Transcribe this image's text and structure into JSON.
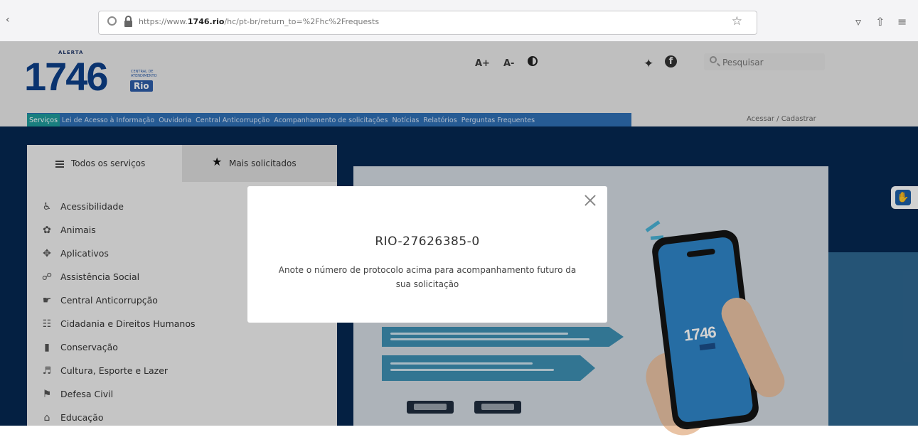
{
  "browser": {
    "url_prefix": "https://www.",
    "url_domain": "1746.rio",
    "url_path": "/hc/pt-br/return_to=%2Fhc%2Frequests"
  },
  "header": {
    "logo_top": "ALERTA",
    "logo_number": "1746",
    "logo_sub": "CENTRAL DE ATENDIMENTO",
    "logo_rio": "Rio",
    "font_increase": "A+",
    "font_decrease": "A-",
    "search_placeholder": "Pesquisar",
    "right_link": "Acessar / Cadastrar"
  },
  "nav": {
    "items": [
      {
        "label": "Serviços",
        "active": true
      },
      {
        "label": "Lei de Acesso à Informação",
        "active": false
      },
      {
        "label": "Ouvidoria",
        "active": false
      },
      {
        "label": "Central Anticorrupção",
        "active": false
      },
      {
        "label": "Acompanhamento de solicitações",
        "active": false
      },
      {
        "label": "Notícias",
        "active": false
      },
      {
        "label": "Relatórios",
        "active": false
      },
      {
        "label": "Perguntas Frequentes",
        "active": false
      }
    ]
  },
  "services": {
    "tab_all": "Todos os serviços",
    "tab_popular": "Mais solicitados",
    "categories": [
      {
        "label": "Acessibilidade",
        "icon": "wheelchair-icon",
        "glyph": "♿"
      },
      {
        "label": "Animais",
        "icon": "paw-icon",
        "glyph": "✿"
      },
      {
        "label": "Aplicativos",
        "icon": "apps-icon",
        "glyph": "✥"
      },
      {
        "label": "Assistência Social",
        "icon": "hands-icon",
        "glyph": "☍"
      },
      {
        "label": "Central Anticorrupção",
        "icon": "megaphone-icon",
        "glyph": "☛"
      },
      {
        "label": "Cidadania e Direitos Humanos",
        "icon": "people-icon",
        "glyph": "☷"
      },
      {
        "label": "Conservação",
        "icon": "cone-icon",
        "glyph": "▮"
      },
      {
        "label": "Cultura, Esporte e Lazer",
        "icon": "theater-icon",
        "glyph": "♬"
      },
      {
        "label": "Defesa Civil",
        "icon": "siren-icon",
        "glyph": "⚑"
      },
      {
        "label": "Educação",
        "icon": "graduation-cap-icon",
        "glyph": "⌂"
      }
    ]
  },
  "modal": {
    "protocol": "RIO-27626385-0",
    "message": "Anote o número de protocolo acima para acompanhamento futuro da sua solicitação"
  },
  "colors": {
    "brand_blue": "#0d3f88",
    "nav_blue": "#2f6fb5",
    "nav_active": "#1f9c9c",
    "page_dark": "#052851"
  }
}
